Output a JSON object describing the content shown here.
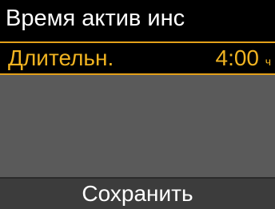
{
  "header": {
    "title": "Время актив инс"
  },
  "setting": {
    "label": "Длительн.",
    "value": "4:00",
    "unit": "ч"
  },
  "footer": {
    "save_label": "Сохранить"
  },
  "colors": {
    "accent": "#e3a019",
    "background": "#000000",
    "panel": "#5a5a5a",
    "softkey_bar": "#3c3c3c",
    "text": "#ffffff"
  }
}
